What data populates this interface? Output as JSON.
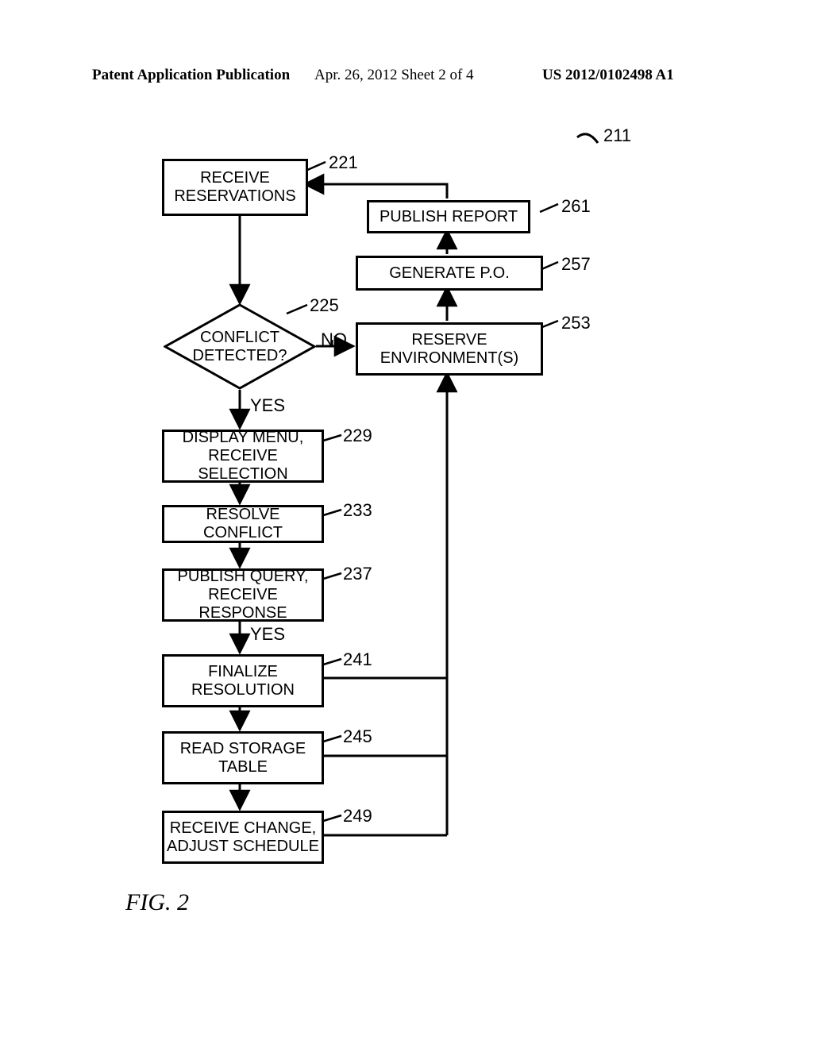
{
  "header": {
    "left": "Patent Application Publication",
    "center": "Apr. 26, 2012  Sheet 2 of 4",
    "right": "US 2012/0102498 A1"
  },
  "figure_label": "FIG. 2",
  "nodes": {
    "n221": {
      "label": "RECEIVE\nRESERVATIONS",
      "ref": "221"
    },
    "n225": {
      "label": "CONFLICT\nDETECTED?",
      "ref": "225"
    },
    "n229": {
      "label": "DISPLAY MENU,\nRECEIVE SELECTION",
      "ref": "229"
    },
    "n233": {
      "label": "RESOLVE CONFLICT",
      "ref": "233"
    },
    "n237": {
      "label": "PUBLISH QUERY,\nRECEIVE RESPONSE",
      "ref": "237"
    },
    "n241": {
      "label": "FINALIZE\nRESOLUTION",
      "ref": "241"
    },
    "n245": {
      "label": "READ STORAGE\nTABLE",
      "ref": "245"
    },
    "n249": {
      "label": "RECEIVE CHANGE,\nADJUST SCHEDULE",
      "ref": "249"
    },
    "n253": {
      "label": "RESERVE\nENVIRONMENT(S)",
      "ref": "253"
    },
    "n257": {
      "label": "GENERATE P.O.",
      "ref": "257"
    },
    "n261": {
      "label": "PUBLISH REPORT",
      "ref": "261"
    }
  },
  "edge_labels": {
    "no": "NO",
    "yes225": "YES",
    "yes237": "YES"
  },
  "figure_ref": "211"
}
